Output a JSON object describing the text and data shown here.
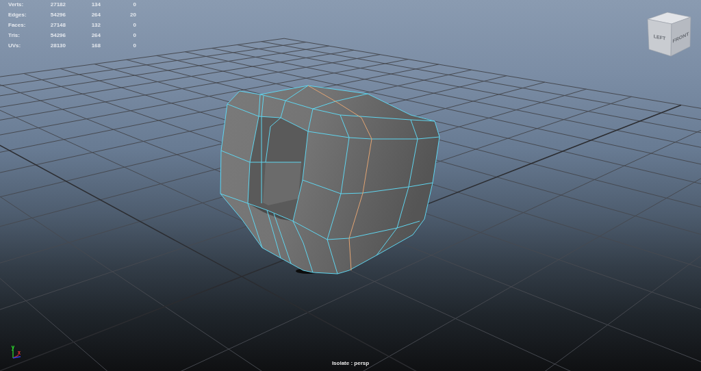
{
  "stats": {
    "rows": [
      {
        "label": "Verts:",
        "values": [
          "27182",
          "134",
          "0"
        ]
      },
      {
        "label": "Edges:",
        "values": [
          "54296",
          "264",
          "20"
        ]
      },
      {
        "label": "Faces:",
        "values": [
          "27148",
          "132",
          "0"
        ]
      },
      {
        "label": "Tris:",
        "values": [
          "54296",
          "264",
          "0"
        ]
      },
      {
        "label": "UVs:",
        "values": [
          "28130",
          "168",
          "0"
        ]
      }
    ]
  },
  "view_cube": {
    "faces": [
      {
        "kind": "left",
        "label": "LEFT"
      },
      {
        "kind": "front",
        "label": "FRONT"
      }
    ]
  },
  "axis_gizmo": {
    "labels": [
      {
        "kind": "y",
        "label": "y"
      },
      {
        "kind": "x",
        "label": "x"
      }
    ]
  },
  "viewport_label": "Isolate : persp"
}
